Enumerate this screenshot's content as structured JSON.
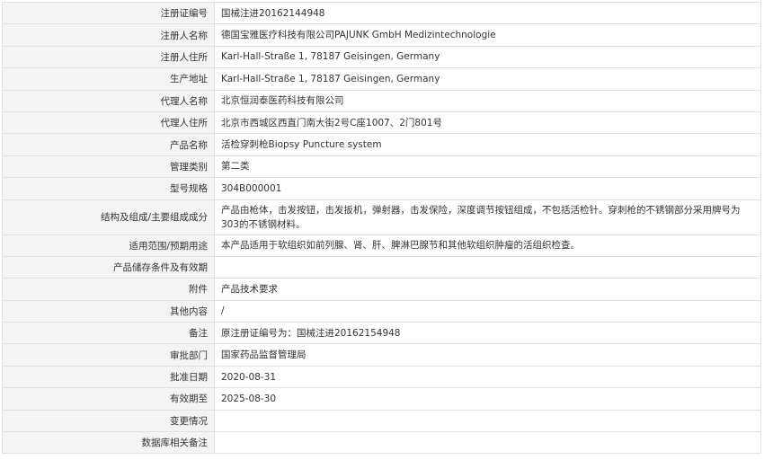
{
  "rows": [
    {
      "label": "注册证编号",
      "value": "国械注进20162144948"
    },
    {
      "label": "注册人名称",
      "value": "德国宝雅医疗科技有限公司PAJUNK GmbH Medizintechnologie"
    },
    {
      "label": "注册人住所",
      "value": "Karl-Hall-Straße 1, 78187 Geisingen, Germany"
    },
    {
      "label": "生产地址",
      "value": "Karl-Hall-Straße 1, 78187 Geisingen, Germany"
    },
    {
      "label": "代理人名称",
      "value": "北京恒润泰医药科技有限公司"
    },
    {
      "label": "代理人住所",
      "value": "北京市西城区西直门南大街2号C座1007、2门801号"
    },
    {
      "label": "产品名称",
      "value": "活检穿刺枪Biopsy Puncture system"
    },
    {
      "label": "管理类别",
      "value": "第二类"
    },
    {
      "label": "型号规格",
      "value": "304B000001"
    },
    {
      "label": "结构及组成/主要组成成分",
      "value": "产品由枪体，击发按钮，击发扳机，弹射器，击发保险，深度调节按钮组成，不包括活检针。穿刺枪的不锈钢部分采用牌号为303的不锈钢材料。"
    },
    {
      "label": "适用范围/预期用途",
      "value": "本产品适用于软组织如前列腺、肾、肝、脾淋巴腺节和其他软组织肿瘤的活组织检查。"
    },
    {
      "label": "产品储存条件及有效期",
      "value": ""
    },
    {
      "label": "附件",
      "value": "产品技术要求"
    },
    {
      "label": "其他内容",
      "value": "/"
    },
    {
      "label": "备注",
      "value": "原注册证编号为：国械注进20162154948"
    },
    {
      "label": "审批部门",
      "value": "国家药品监督管理局"
    },
    {
      "label": "批准日期",
      "value": "2020-08-31"
    },
    {
      "label": "有效期至",
      "value": "2025-08-30"
    },
    {
      "label": "变更情况",
      "value": ""
    },
    {
      "label": "数据库相关备注",
      "value": ""
    }
  ]
}
